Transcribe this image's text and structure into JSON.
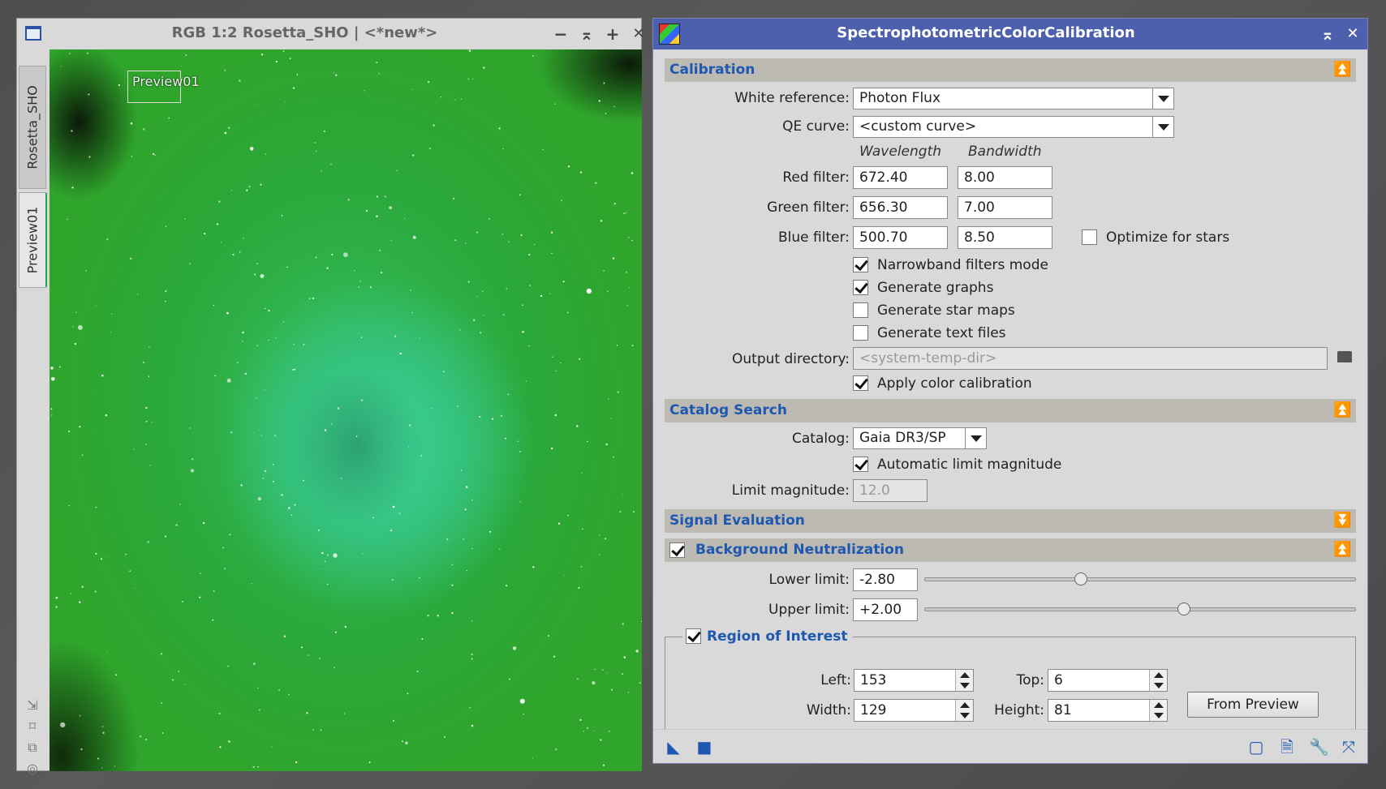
{
  "image_window": {
    "title": "RGB 1:2 Rosetta_SHO | <*new*>",
    "controls": {
      "minimize": "−",
      "shade": "⌅",
      "maximize": "+",
      "close": "✕"
    },
    "tabs": [
      "Rosetta_SHO",
      "Preview01"
    ],
    "preview_label": "Preview01",
    "side_icons": [
      "⇲",
      "⌑",
      "⧉",
      "◎"
    ]
  },
  "dialog": {
    "title": "SpectrophotometricColorCalibration",
    "controls": {
      "shade": "⌅",
      "close": "✕"
    },
    "calibration": {
      "section_label": "Calibration",
      "white_reference_label": "White reference:",
      "white_reference_value": "Photon Flux",
      "qe_curve_label": "QE curve:",
      "qe_curve_value": "<custom curve>",
      "wavelength_header": "Wavelength",
      "bandwidth_header": "Bandwidth",
      "filters": [
        {
          "label": "Red filter:",
          "wavelength": "672.40",
          "bandwidth": "8.00"
        },
        {
          "label": "Green filter:",
          "wavelength": "656.30",
          "bandwidth": "7.00"
        },
        {
          "label": "Blue filter:",
          "wavelength": "500.70",
          "bandwidth": "8.50"
        }
      ],
      "optimize_for_stars": "Optimize for stars",
      "narrowband_mode": "Narrowband filters mode",
      "generate_graphs": "Generate graphs",
      "generate_star_maps": "Generate star maps",
      "generate_text_files": "Generate text files",
      "output_directory_label": "Output directory:",
      "output_directory_placeholder": "<system-temp-dir>",
      "apply_color_calibration": "Apply color calibration"
    },
    "catalog_search": {
      "section_label": "Catalog Search",
      "catalog_label": "Catalog:",
      "catalog_value": "Gaia DR3/SP",
      "automatic_limit_magnitude": "Automatic limit magnitude",
      "limit_magnitude_label": "Limit magnitude:",
      "limit_magnitude_value": "12.0"
    },
    "signal_evaluation": {
      "section_label": "Signal Evaluation"
    },
    "background_neutralization": {
      "section_label": "Background Neutralization",
      "lower_limit_label": "Lower limit:",
      "lower_limit_value": "-2.80",
      "lower_limit_slider": 0.36,
      "upper_limit_label": "Upper limit:",
      "upper_limit_value": "+2.00",
      "upper_limit_slider": 0.6,
      "roi": {
        "label": "Region of Interest",
        "left_label": "Left:",
        "left_value": "153",
        "top_label": "Top:",
        "top_value": "6",
        "width_label": "Width:",
        "width_value": "129",
        "height_label": "Height:",
        "height_value": "81",
        "from_preview": "From Preview"
      }
    },
    "bottom_icons": {
      "new_instance": "◣",
      "apply_global": "■",
      "preview": "▢",
      "browse_doc": "🗎",
      "reset": "🔧",
      "track": "⤧"
    },
    "arrow_up": "⏫",
    "arrow_down": "⏬"
  },
  "colors": {
    "accent": "#1f58b0",
    "titlebar": "#4d60ad",
    "panel": "#d9d9d9",
    "section": "#bcbab2"
  }
}
